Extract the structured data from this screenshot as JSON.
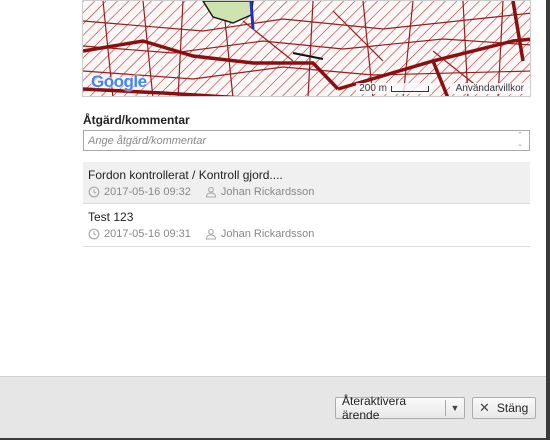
{
  "map": {
    "logo": "Google",
    "scale_label": "200 m",
    "terms_label": "Användarvillkor"
  },
  "comment": {
    "label": "Åtgärd/kommentar",
    "placeholder": "Ange åtgärd/kommentar",
    "value": ""
  },
  "entries": [
    {
      "text": "Fordon kontrollerat / Kontroll gjord....",
      "timestamp": "2017-05-16 09:32",
      "author": "Johan Rickardsson",
      "time_icon": "clock-icon",
      "author_icon": "user-icon"
    },
    {
      "text": "Test 123",
      "timestamp": "2017-05-16 09:31",
      "author": "Johan Rickardsson",
      "time_icon": "clock-icon",
      "author_icon": "user-icon"
    }
  ],
  "footer": {
    "reactivate_label": "Återaktivera ärende",
    "close_label": "Stäng",
    "close_icon": "close-icon",
    "dropdown_icon": "caret-down-icon"
  }
}
